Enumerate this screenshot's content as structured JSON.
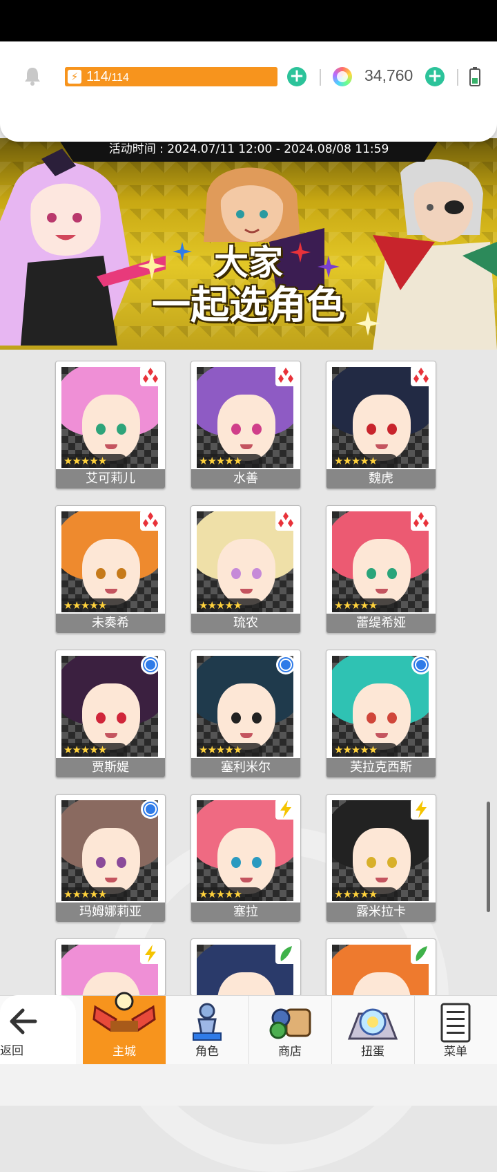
{
  "header": {
    "stamina_current": "114",
    "stamina_max": "/114",
    "stamina_fraction": 1.0,
    "gems": "34,760"
  },
  "banner": {
    "event_time": "活动时间 : 2024.07/11 12:00 - 2024.08/08 11:59",
    "title_line1": "大家",
    "title_line2": "一起选角色"
  },
  "characters": [
    {
      "name": "艾可莉儿",
      "element": "red-diamond-icon",
      "stars": "★★★★★"
    },
    {
      "name": "水善",
      "element": "red-diamond-icon",
      "stars": "★★★★★"
    },
    {
      "name": "魏虎",
      "element": "red-diamond-icon",
      "stars": "★★★★★"
    },
    {
      "name": "未奏希",
      "element": "red-diamond-icon",
      "stars": "★★★★★"
    },
    {
      "name": "琉农",
      "element": "red-diamond-icon",
      "stars": "★★★★★"
    },
    {
      "name": "蕾缇希娅",
      "element": "red-diamond-icon",
      "stars": "★★★★★"
    },
    {
      "name": "贾斯媞",
      "element": "blue-circle-icon",
      "stars": "★★★★★"
    },
    {
      "name": "塞利米尔",
      "element": "blue-circle-icon",
      "stars": "★★★★★"
    },
    {
      "name": "芙拉克西斯",
      "element": "blue-circle-icon",
      "stars": "★★★★★"
    },
    {
      "name": "玛姆娜莉亚",
      "element": "blue-circle-icon",
      "stars": "★★★★★"
    },
    {
      "name": "塞拉",
      "element": "yellow-bolt-icon",
      "stars": "★★★★★"
    },
    {
      "name": "露米拉卡",
      "element": "yellow-bolt-icon",
      "stars": "★★★★★"
    }
  ],
  "nav": {
    "back": "返回",
    "town": "主城",
    "character": "角色",
    "shop": "商店",
    "gacha": "扭蛋",
    "menu": "菜单"
  },
  "colors": {
    "accent_orange": "#f7941d",
    "plus_green": "#2cc39a",
    "element_red": "#e8323a",
    "element_blue": "#2f7be8",
    "element_yellow": "#f5c400"
  }
}
